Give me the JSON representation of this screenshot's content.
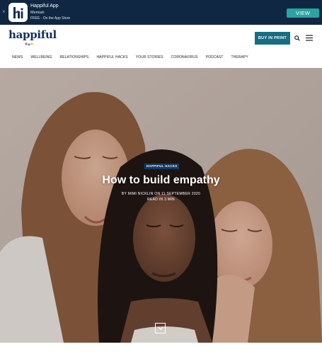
{
  "app_banner": {
    "close_label": "×",
    "app_name": "Happiful App",
    "developer": "Memiah",
    "store_line": "FREE - On the App Store",
    "view_label": "VIEW",
    "icon": "happiful-h-icon"
  },
  "header": {
    "logo_text": "happiful",
    "buy_in_print_label": "BUY IN PRINT",
    "search_icon": "search-icon",
    "menu_icon": "hamburger-menu-icon"
  },
  "nav": {
    "items": [
      "NEWS",
      "WELLBEING",
      "RELATIONSHIPS",
      "HAPPIFUL HACKS",
      "YOUR STORIES",
      "CORONAVIRUS",
      "PODCAST",
      "THERAPY"
    ]
  },
  "hero": {
    "tag": "HAPPIFUL HACKS",
    "title": "How to build empathy",
    "byline": "BY MIMI NICKLIN ON 11 SEPTEMBER 2020",
    "read_time": "READ IN 3 MIN",
    "scroll_icon": "chevron-down-icon"
  },
  "colors": {
    "banner_bg": "#0f2742",
    "view_button": "#2aa3a3",
    "brand_navy": "#15305a",
    "print_button": "#156f82",
    "tag_bg": "#123a66"
  }
}
